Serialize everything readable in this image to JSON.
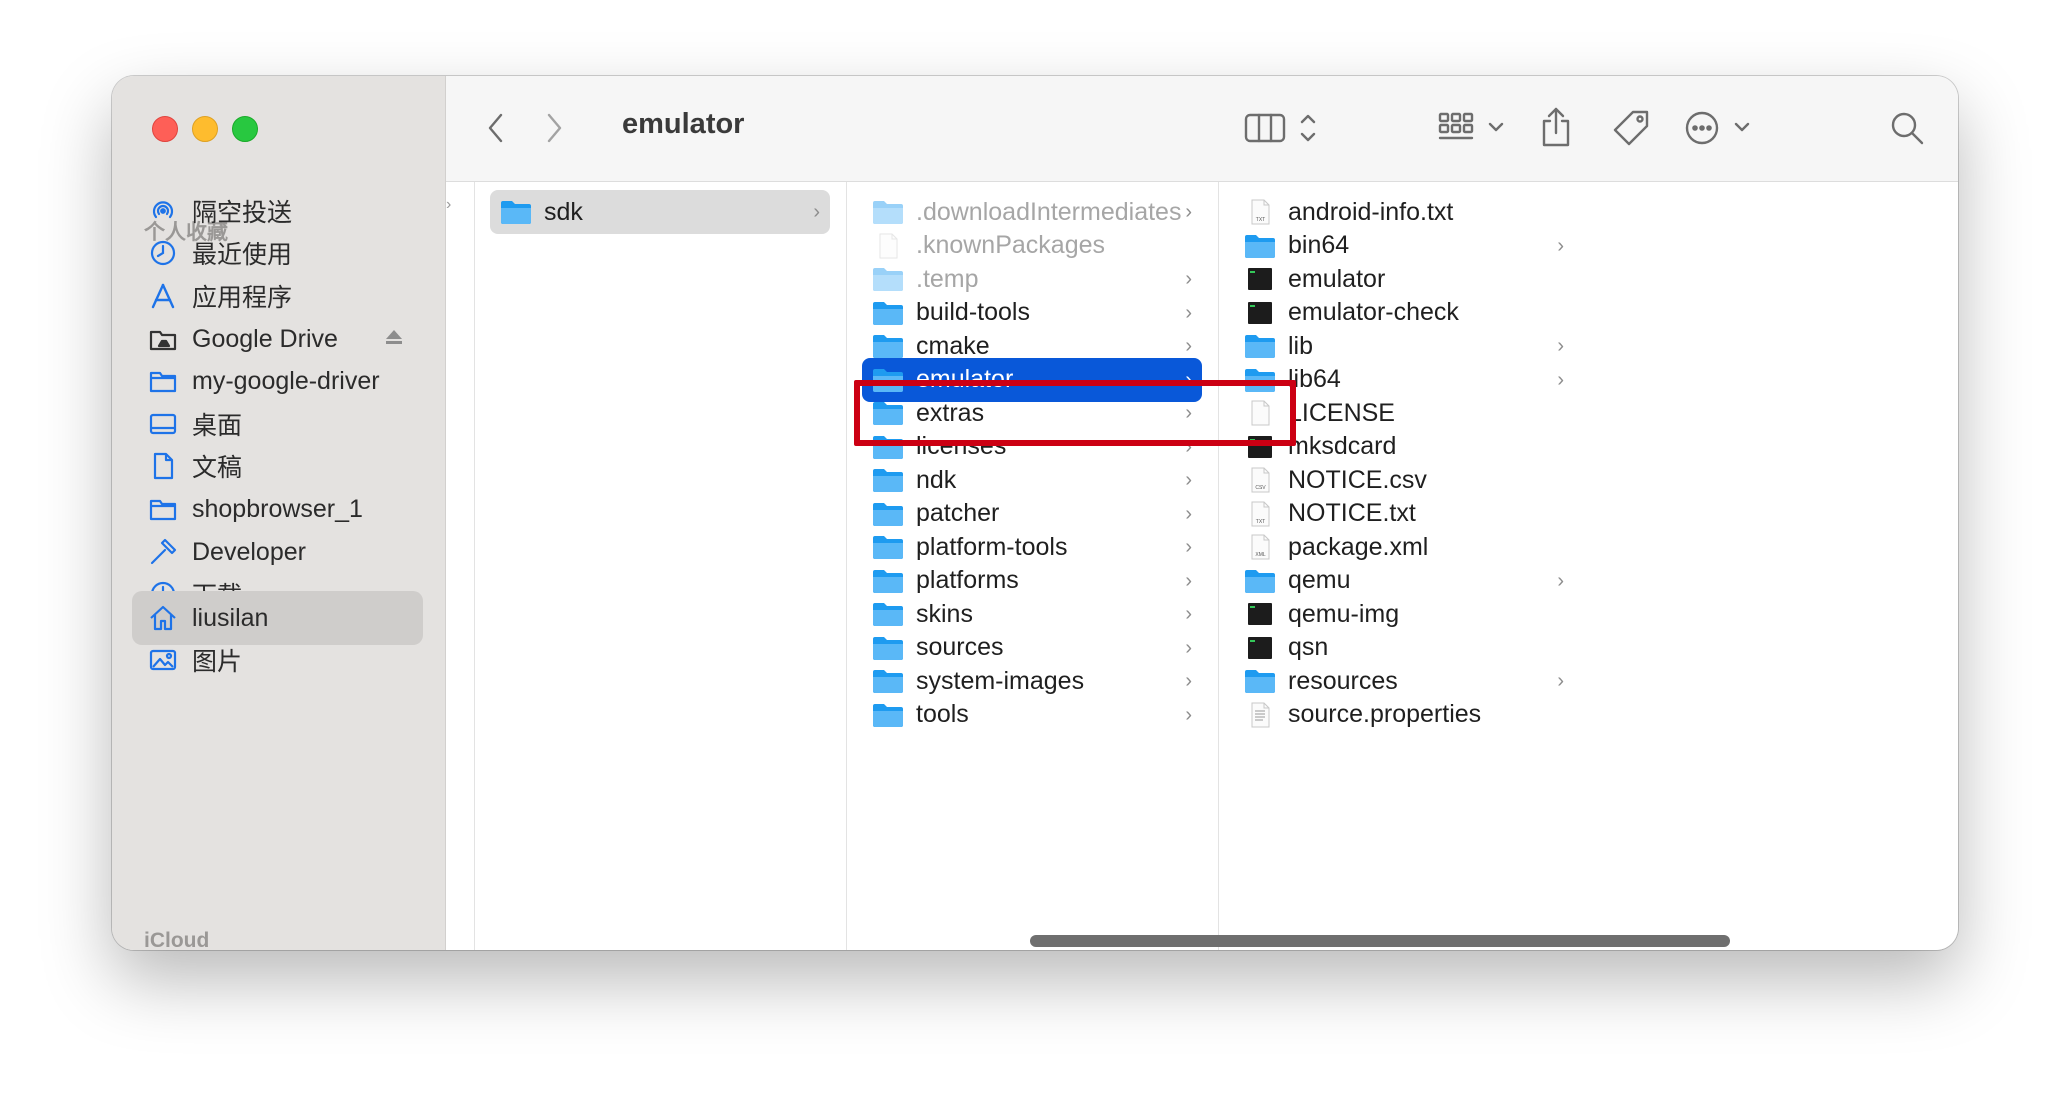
{
  "window": {
    "title": "emulator"
  },
  "sidebar": {
    "favorites_label": "个人收藏",
    "icloud_label": "iCloud",
    "items": [
      {
        "label": "隔空投送",
        "icon": "airdrop-icon"
      },
      {
        "label": "最近使用",
        "icon": "clock-icon"
      },
      {
        "label": "应用程序",
        "icon": "applications-icon"
      },
      {
        "label": "Google Drive",
        "icon": "drive-folder-icon",
        "eject": "eject-icon"
      },
      {
        "label": "my-google-driver",
        "icon": "folder-icon"
      },
      {
        "label": "桌面",
        "icon": "desktop-icon"
      },
      {
        "label": "文稿",
        "icon": "document-icon"
      },
      {
        "label": "shopbrowser_1",
        "icon": "folder-icon"
      },
      {
        "label": "Developer",
        "icon": "hammer-icon"
      },
      {
        "label": "下载",
        "icon": "download-icon"
      },
      {
        "label": "liusilan",
        "icon": "home-icon",
        "selected": true
      },
      {
        "label": "图片",
        "icon": "photos-icon"
      }
    ]
  },
  "toolbar": {
    "back_icon": "chevron-left-icon",
    "forward_icon": "chevron-right-icon",
    "view_icon": "column-view-icon",
    "group_icon": "grid-group-icon",
    "share_icon": "share-icon",
    "tag_icon": "tag-icon",
    "more_icon": "ellipsis-circle-icon",
    "search_icon": "search-icon"
  },
  "columns": [
    {
      "items": [
        {
          "name": "sdk",
          "type": "folder",
          "chevron": true,
          "state": "selected-inactive"
        }
      ]
    },
    {
      "items": [
        {
          "name": ".downloadIntermediates",
          "type": "folder",
          "chevron": true,
          "dim": true
        },
        {
          "name": ".knownPackages",
          "type": "file",
          "chevron": false,
          "dim": true
        },
        {
          "name": ".temp",
          "type": "folder",
          "chevron": true,
          "dim": true
        },
        {
          "name": "build-tools",
          "type": "folder",
          "chevron": true
        },
        {
          "name": "cmake",
          "type": "folder",
          "chevron": true
        },
        {
          "name": "emulator",
          "type": "folder",
          "chevron": true,
          "state": "selected-active"
        },
        {
          "name": "extras",
          "type": "folder",
          "chevron": true
        },
        {
          "name": "licenses",
          "type": "folder",
          "chevron": true
        },
        {
          "name": "ndk",
          "type": "folder",
          "chevron": true
        },
        {
          "name": "patcher",
          "type": "folder",
          "chevron": true
        },
        {
          "name": "platform-tools",
          "type": "folder",
          "chevron": true
        },
        {
          "name": "platforms",
          "type": "folder",
          "chevron": true
        },
        {
          "name": "skins",
          "type": "folder",
          "chevron": true
        },
        {
          "name": "sources",
          "type": "folder",
          "chevron": true
        },
        {
          "name": "system-images",
          "type": "folder",
          "chevron": true
        },
        {
          "name": "tools",
          "type": "folder",
          "chevron": true
        }
      ]
    },
    {
      "items": [
        {
          "name": "android-info.txt",
          "type": "txt",
          "chevron": false
        },
        {
          "name": "bin64",
          "type": "folder",
          "chevron": true
        },
        {
          "name": "emulator",
          "type": "exec",
          "chevron": false
        },
        {
          "name": "emulator-check",
          "type": "exec",
          "chevron": false
        },
        {
          "name": "lib",
          "type": "folder",
          "chevron": true
        },
        {
          "name": "lib64",
          "type": "folder",
          "chevron": true
        },
        {
          "name": "LICENSE",
          "type": "file",
          "chevron": false
        },
        {
          "name": "mksdcard",
          "type": "exec",
          "chevron": false
        },
        {
          "name": "NOTICE.csv",
          "type": "csv",
          "chevron": false
        },
        {
          "name": "NOTICE.txt",
          "type": "txt",
          "chevron": false
        },
        {
          "name": "package.xml",
          "type": "xml",
          "chevron": false
        },
        {
          "name": "qemu",
          "type": "folder",
          "chevron": true
        },
        {
          "name": "qemu-img",
          "type": "exec",
          "chevron": false
        },
        {
          "name": "qsn",
          "type": "exec",
          "chevron": false
        },
        {
          "name": "resources",
          "type": "folder",
          "chevron": true
        },
        {
          "name": "source.properties",
          "type": "props",
          "chevron": false
        }
      ]
    }
  ],
  "colors": {
    "accent": "#0958d9",
    "folder": "#1e9bf0",
    "annotation": "#cc0013",
    "traffic_red": "#fe5f57",
    "traffic_yellow": "#febc2e",
    "traffic_green": "#28c840"
  }
}
